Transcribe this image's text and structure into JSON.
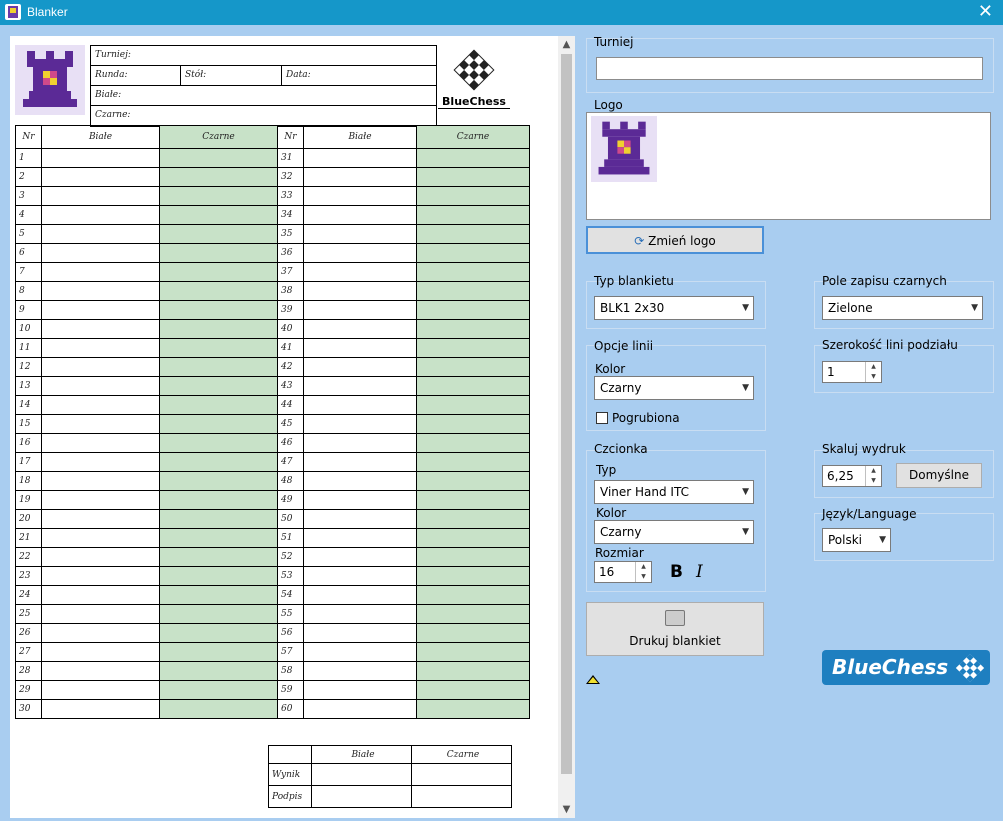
{
  "window": {
    "title": "Blanker",
    "close_glyph": "✕"
  },
  "sheet": {
    "header": {
      "tournament_label": "Turniej:",
      "round_label": "Runda:",
      "table_label": "Stół:",
      "date_label": "Data:",
      "white_label": "Białe:",
      "black_label": "Czarne:"
    },
    "brand_text": "BlueChess",
    "columns": [
      "Nr",
      "Białe",
      "Czarne",
      "Nr",
      "Białe",
      "Czarne"
    ],
    "rows_left": [
      "1",
      "2",
      "3",
      "4",
      "5",
      "6",
      "7",
      "8",
      "9",
      "10",
      "11",
      "12",
      "13",
      "14",
      "15",
      "16",
      "17",
      "18",
      "19",
      "20",
      "21",
      "22",
      "23",
      "24",
      "25",
      "26",
      "27",
      "28",
      "29",
      "30"
    ],
    "rows_right": [
      "31",
      "32",
      "33",
      "34",
      "35",
      "36",
      "37",
      "38",
      "39",
      "40",
      "41",
      "42",
      "43",
      "44",
      "45",
      "46",
      "47",
      "48",
      "49",
      "50",
      "51",
      "52",
      "53",
      "54",
      "55",
      "56",
      "57",
      "58",
      "59",
      "60"
    ],
    "result": {
      "white": "Białe",
      "black": "Czarne",
      "score": "Wynik",
      "sign": "Podpis"
    }
  },
  "settings": {
    "tournament_label": "Turniej",
    "tournament_value": "",
    "logo_label": "Logo",
    "change_logo": "Zmień logo",
    "sheet_type_label": "Typ blankietu",
    "sheet_type_value": "BLK1 2x30",
    "black_field_label": "Pole zapisu czarnych",
    "black_field_value": "Zielone",
    "line_opts_label": "Opcje linii",
    "line_color_label": "Kolor",
    "line_color_value": "Czarny",
    "bold_label": "Pogrubiona",
    "divider_label": "Szerokość lini podziału",
    "divider_value": "1",
    "font_label": "Czcionka",
    "font_type_label": "Typ",
    "font_type_value": "Viner Hand ITC",
    "font_color_label": "Kolor",
    "font_color_value": "Czarny",
    "font_size_label": "Rozmiar",
    "font_size_value": "16",
    "bold_glyph": "B",
    "italic_glyph": "I",
    "scale_label": "Skaluj wydruk",
    "scale_value": "6,25",
    "default_btn": "Domyślne",
    "lang_label": "Język/Language",
    "lang_value": "Polski",
    "print_btn": "Drukuj blankiet",
    "brand_logo_text": "BlueChess"
  },
  "colors": {
    "titlebar": "#1597c9",
    "panel": "#a9cdf0",
    "black_field": "#c8e2c8",
    "brand": "#1e7fc0"
  }
}
